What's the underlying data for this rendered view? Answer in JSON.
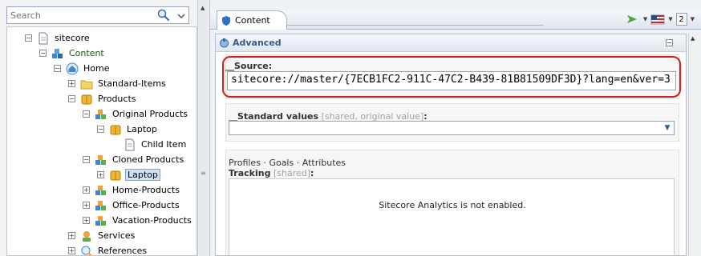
{
  "search": {
    "placeholder": "Search"
  },
  "tree": {
    "items": [
      {
        "label": "sitecore",
        "toggle": "−"
      },
      {
        "label": "Content",
        "toggle": "−"
      },
      {
        "label": "Home",
        "toggle": "−"
      },
      {
        "label": "Standard-Items",
        "toggle": "+"
      },
      {
        "label": "Products",
        "toggle": "−"
      },
      {
        "label": "Original Products",
        "toggle": "−"
      },
      {
        "label": "Laptop",
        "toggle": "−"
      },
      {
        "label": "Child Item",
        "toggle": ""
      },
      {
        "label": "Cloned Products",
        "toggle": "−"
      },
      {
        "label": "Laptop",
        "toggle": "+"
      },
      {
        "label": "Home-Products",
        "toggle": "+"
      },
      {
        "label": "Office-Products",
        "toggle": "+"
      },
      {
        "label": "Vacation-Products",
        "toggle": "+"
      },
      {
        "label": "Services",
        "toggle": "+"
      },
      {
        "label": "References",
        "toggle": "+"
      }
    ]
  },
  "tab": {
    "label": "Content"
  },
  "toolbar": {
    "number_box": "2"
  },
  "section": {
    "title": "Advanced",
    "collapse": "−"
  },
  "source": {
    "label": "__Source:",
    "value": "sitecore://master/{7ECB1FC2-911C-47C2-B439-81B81509DF3D}?lang=en&ver=3"
  },
  "standard_values": {
    "label": "__Standard values",
    "meta": "[shared, original value]",
    "suffix": ":",
    "value": ""
  },
  "tracking": {
    "link1": "Profiles",
    "sep1": " · ",
    "link2": "Goals",
    "sep2": " · ",
    "link3": "Attributes",
    "label": "Tracking",
    "meta": "[shared]",
    "suffix": ":",
    "message": "Sitecore Analytics is not enabled."
  },
  "colors": {
    "highlight": "#e0151a",
    "section_title": "#365a8c",
    "content_label": "#15630f",
    "selection": "#cfe2f7"
  }
}
